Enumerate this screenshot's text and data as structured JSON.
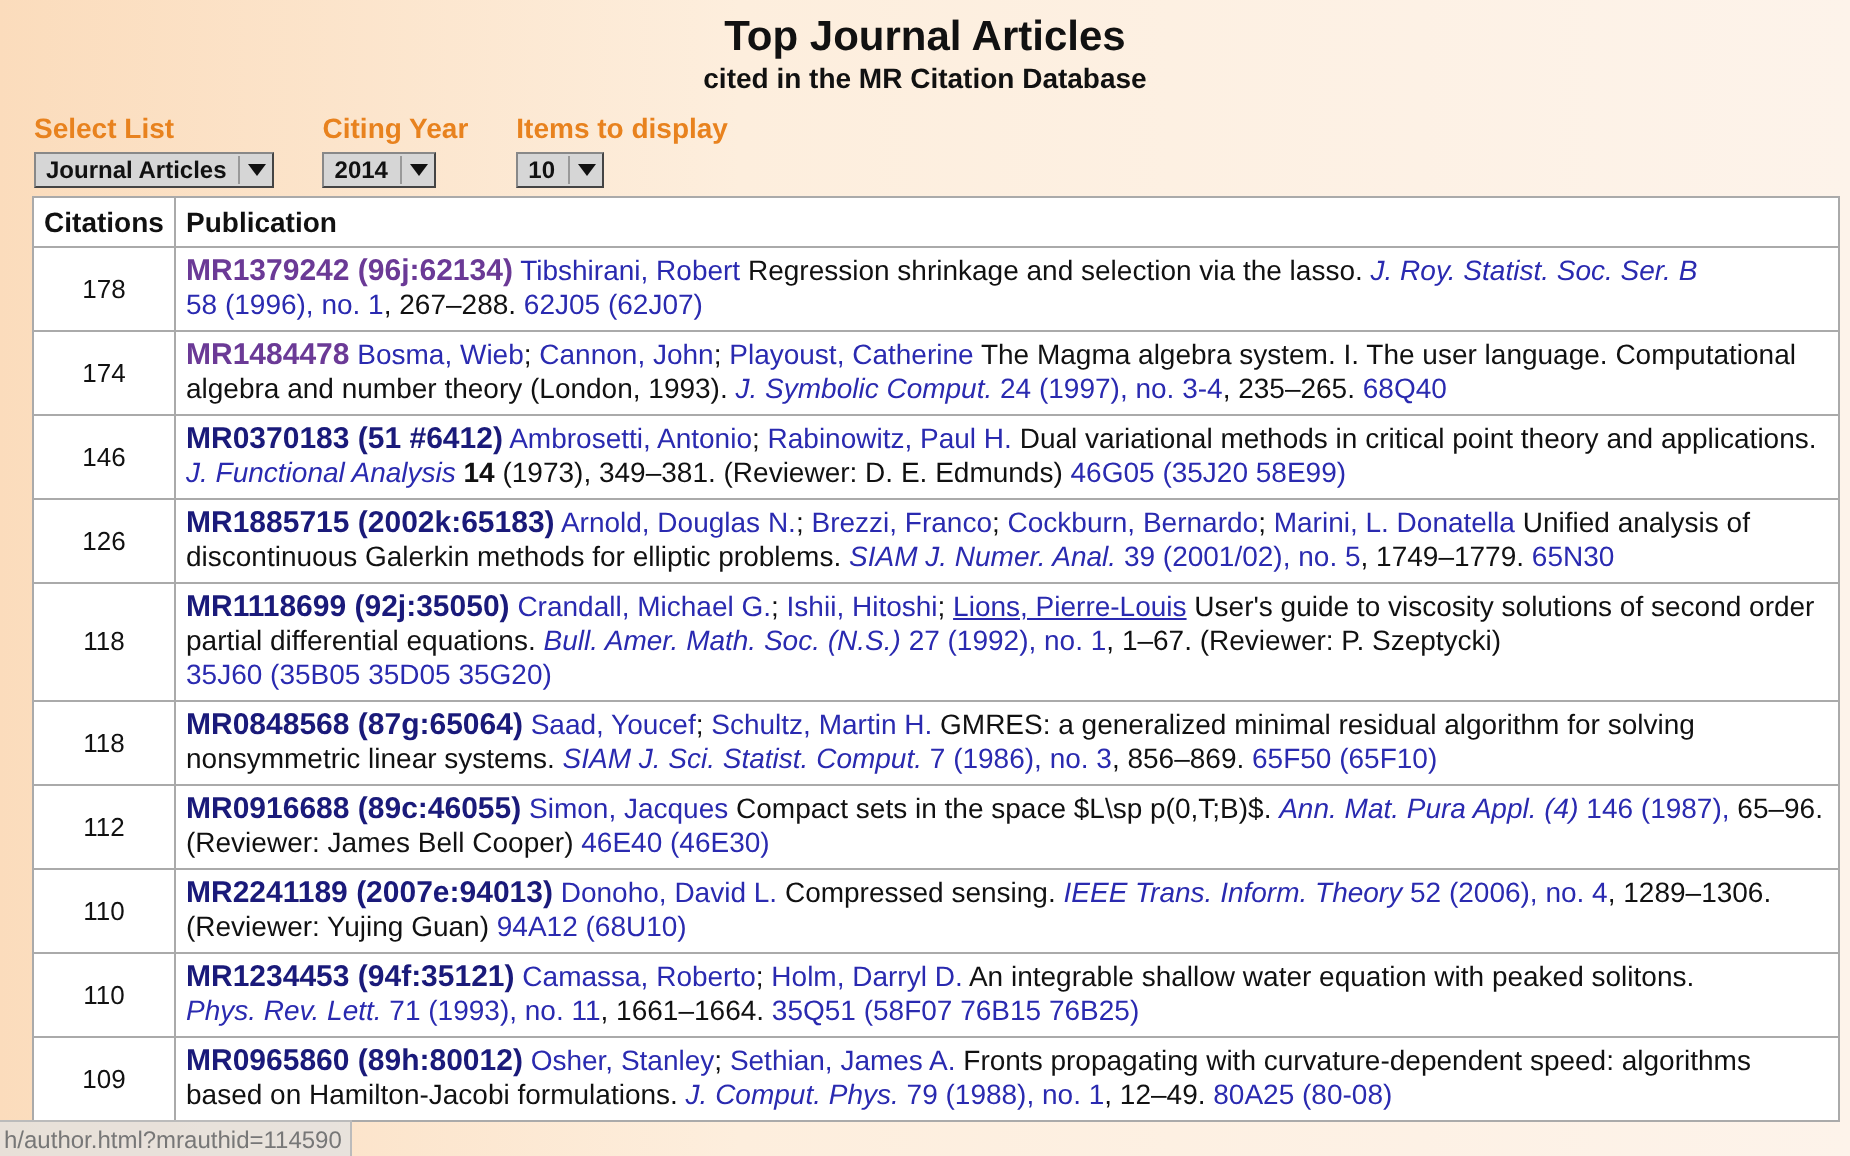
{
  "title": "Top Journal Articles",
  "subtitle": "cited in the MR Citation Database",
  "controls": [
    {
      "label": "Select List",
      "value": "Journal Articles"
    },
    {
      "label": "Citing Year",
      "value": "2014"
    },
    {
      "label": "Items to display",
      "value": "10"
    }
  ],
  "table": {
    "columns": [
      "Citations",
      "Publication"
    ],
    "rows": [
      {
        "citations": "178",
        "segments": [
          {
            "kind": "mr",
            "text": "MR1379242 (96j:62134)",
            "visited": true
          },
          {
            "kind": "author",
            "text": "Tibshirani, Robert",
            "hovered": false
          },
          {
            "kind": "text",
            "text": " Regression shrinkage and selection via the lasso. "
          },
          {
            "kind": "journal",
            "text": "J. Roy. Statist. Soc. Ser. B"
          },
          {
            "kind": "issue",
            "text": "58 (1996), no. 1"
          },
          {
            "kind": "text",
            "text": ", 267–288. "
          },
          {
            "kind": "class",
            "text": "62J05 (62J07)"
          }
        ]
      },
      {
        "citations": "174",
        "segments": [
          {
            "kind": "mr",
            "text": "MR1484478",
            "visited": true
          },
          {
            "kind": "author",
            "text": "Bosma, Wieb",
            "hovered": false
          },
          {
            "kind": "text",
            "text": "; "
          },
          {
            "kind": "author",
            "text": "Cannon, John",
            "hovered": false
          },
          {
            "kind": "text",
            "text": "; "
          },
          {
            "kind": "author",
            "text": "Playoust, Catherine",
            "hovered": false
          },
          {
            "kind": "text",
            "text": " The Magma algebra system. I. The user language. Computational algebra and number theory (London, 1993). "
          },
          {
            "kind": "journal",
            "text": "J. Symbolic Comput."
          },
          {
            "kind": "issue",
            "text": "24 (1997), no. 3-4"
          },
          {
            "kind": "text",
            "text": ", 235–265. "
          },
          {
            "kind": "class",
            "text": "68Q40"
          }
        ]
      },
      {
        "citations": "146",
        "segments": [
          {
            "kind": "mr",
            "text": "MR0370183 (51 #6412)",
            "visited": false
          },
          {
            "kind": "author",
            "text": "Ambrosetti, Antonio",
            "hovered": false
          },
          {
            "kind": "text",
            "text": "; "
          },
          {
            "kind": "author",
            "text": "Rabinowitz, Paul H.",
            "hovered": false
          },
          {
            "kind": "text",
            "text": " Dual variational methods in critical point theory and applications. "
          },
          {
            "kind": "journal",
            "text": "J. Functional Analysis"
          },
          {
            "kind": "bold",
            "text": "14"
          },
          {
            "kind": "text",
            "text": " (1973), 349–381. (Reviewer: D. E. Edmunds) "
          },
          {
            "kind": "class",
            "text": "46G05 (35J20 58E99)"
          }
        ]
      },
      {
        "citations": "126",
        "segments": [
          {
            "kind": "mr",
            "text": "MR1885715 (2002k:65183)",
            "visited": false
          },
          {
            "kind": "author",
            "text": "Arnold, Douglas N.",
            "hovered": false
          },
          {
            "kind": "text",
            "text": "; "
          },
          {
            "kind": "author",
            "text": "Brezzi, Franco",
            "hovered": false
          },
          {
            "kind": "text",
            "text": "; "
          },
          {
            "kind": "author",
            "text": "Cockburn, Bernardo",
            "hovered": false
          },
          {
            "kind": "text",
            "text": "; "
          },
          {
            "kind": "author",
            "text": "Marini, L. Donatella",
            "hovered": false
          },
          {
            "kind": "text",
            "text": " Unified analysis of discontinuous Galerkin methods for elliptic problems. "
          },
          {
            "kind": "journal",
            "text": "SIAM J. Numer. Anal."
          },
          {
            "kind": "issue",
            "text": "39 (2001/02), no. 5"
          },
          {
            "kind": "text",
            "text": ", 1749–1779. "
          },
          {
            "kind": "class",
            "text": "65N30"
          }
        ]
      },
      {
        "citations": "118",
        "segments": [
          {
            "kind": "mr",
            "text": "MR1118699 (92j:35050)",
            "visited": false
          },
          {
            "kind": "author",
            "text": "Crandall, Michael G.",
            "hovered": false
          },
          {
            "kind": "text",
            "text": "; "
          },
          {
            "kind": "author",
            "text": "Ishii, Hitoshi",
            "hovered": false
          },
          {
            "kind": "text",
            "text": "; "
          },
          {
            "kind": "author",
            "text": "Lions, Pierre-Louis",
            "hovered": true
          },
          {
            "kind": "text",
            "text": " User's guide to viscosity solutions of second order partial differential equations. "
          },
          {
            "kind": "journal",
            "text": "Bull. Amer. Math. Soc. (N.S.)"
          },
          {
            "kind": "issue",
            "text": "27 (1992), no. 1"
          },
          {
            "kind": "text",
            "text": ", 1–67. (Reviewer: P. Szeptycki) "
          },
          {
            "kind": "class",
            "text": "35J60 (35B05 35D05 35G20)"
          }
        ]
      },
      {
        "citations": "118",
        "segments": [
          {
            "kind": "mr",
            "text": "MR0848568 (87g:65064)",
            "visited": false
          },
          {
            "kind": "author",
            "text": "Saad, Youcef",
            "hovered": false
          },
          {
            "kind": "text",
            "text": "; "
          },
          {
            "kind": "author",
            "text": "Schultz, Martin H.",
            "hovered": false
          },
          {
            "kind": "text",
            "text": " GMRES: a generalized minimal residual algorithm for solving nonsymmetric linear systems. "
          },
          {
            "kind": "journal",
            "text": "SIAM J. Sci. Statist. Comput."
          },
          {
            "kind": "issue",
            "text": "7 (1986), no. 3"
          },
          {
            "kind": "text",
            "text": ", 856–869. "
          },
          {
            "kind": "class",
            "text": "65F50 (65F10)"
          }
        ]
      },
      {
        "citations": "112",
        "segments": [
          {
            "kind": "mr",
            "text": "MR0916688 (89c:46055)",
            "visited": false
          },
          {
            "kind": "author",
            "text": "Simon, Jacques",
            "hovered": false
          },
          {
            "kind": "text",
            "text": " Compact sets in the space $L\\sp p(0,T;B)$. "
          },
          {
            "kind": "journal",
            "text": "Ann. Mat. Pura Appl. (4)"
          },
          {
            "kind": "issue",
            "text": "146 (1987),"
          },
          {
            "kind": "text",
            "text": " 65–96. (Reviewer: James Bell Cooper) "
          },
          {
            "kind": "class",
            "text": "46E40 (46E30)"
          }
        ]
      },
      {
        "citations": "110",
        "segments": [
          {
            "kind": "mr",
            "text": "MR2241189 (2007e:94013)",
            "visited": false
          },
          {
            "kind": "author",
            "text": "Donoho, David L.",
            "hovered": false
          },
          {
            "kind": "text",
            "text": " Compressed sensing. "
          },
          {
            "kind": "journal",
            "text": "IEEE Trans. Inform. Theory"
          },
          {
            "kind": "issue",
            "text": "52 (2006), no. 4"
          },
          {
            "kind": "text",
            "text": ", 1289–1306. (Reviewer: Yujing Guan) "
          },
          {
            "kind": "class",
            "text": "94A12 (68U10)"
          }
        ]
      },
      {
        "citations": "110",
        "segments": [
          {
            "kind": "mr",
            "text": "MR1234453 (94f:35121)",
            "visited": false
          },
          {
            "kind": "author",
            "text": "Camassa, Roberto",
            "hovered": false
          },
          {
            "kind": "text",
            "text": "; "
          },
          {
            "kind": "author",
            "text": "Holm, Darryl D.",
            "hovered": false
          },
          {
            "kind": "text",
            "text": " An integrable shallow water equation with peaked solitons. "
          },
          {
            "kind": "journal",
            "text": "Phys. Rev. Lett."
          },
          {
            "kind": "issue",
            "text": "71 (1993), no. 11"
          },
          {
            "kind": "text",
            "text": ", 1661–1664. "
          },
          {
            "kind": "class",
            "text": "35Q51 (58F07 76B15 76B25)"
          }
        ]
      },
      {
        "citations": "109",
        "segments": [
          {
            "kind": "mr",
            "text": "MR0965860 (89h:80012)",
            "visited": false
          },
          {
            "kind": "author",
            "text": "Osher, Stanley",
            "hovered": false
          },
          {
            "kind": "text",
            "text": "; "
          },
          {
            "kind": "author",
            "text": "Sethian, James A.",
            "hovered": false
          },
          {
            "kind": "text",
            "text": " Fronts propagating with curvature-dependent speed: algorithms based on Hamilton-Jacobi formulations. "
          },
          {
            "kind": "journal",
            "text": "J. Comput. Phys."
          },
          {
            "kind": "issue",
            "text": "79 (1988), no. 1"
          },
          {
            "kind": "text",
            "text": ", 12–49. "
          },
          {
            "kind": "class",
            "text": "80A25 (80-08)"
          }
        ]
      }
    ]
  },
  "status_bar": "h/author.html?mrauthid=114590"
}
